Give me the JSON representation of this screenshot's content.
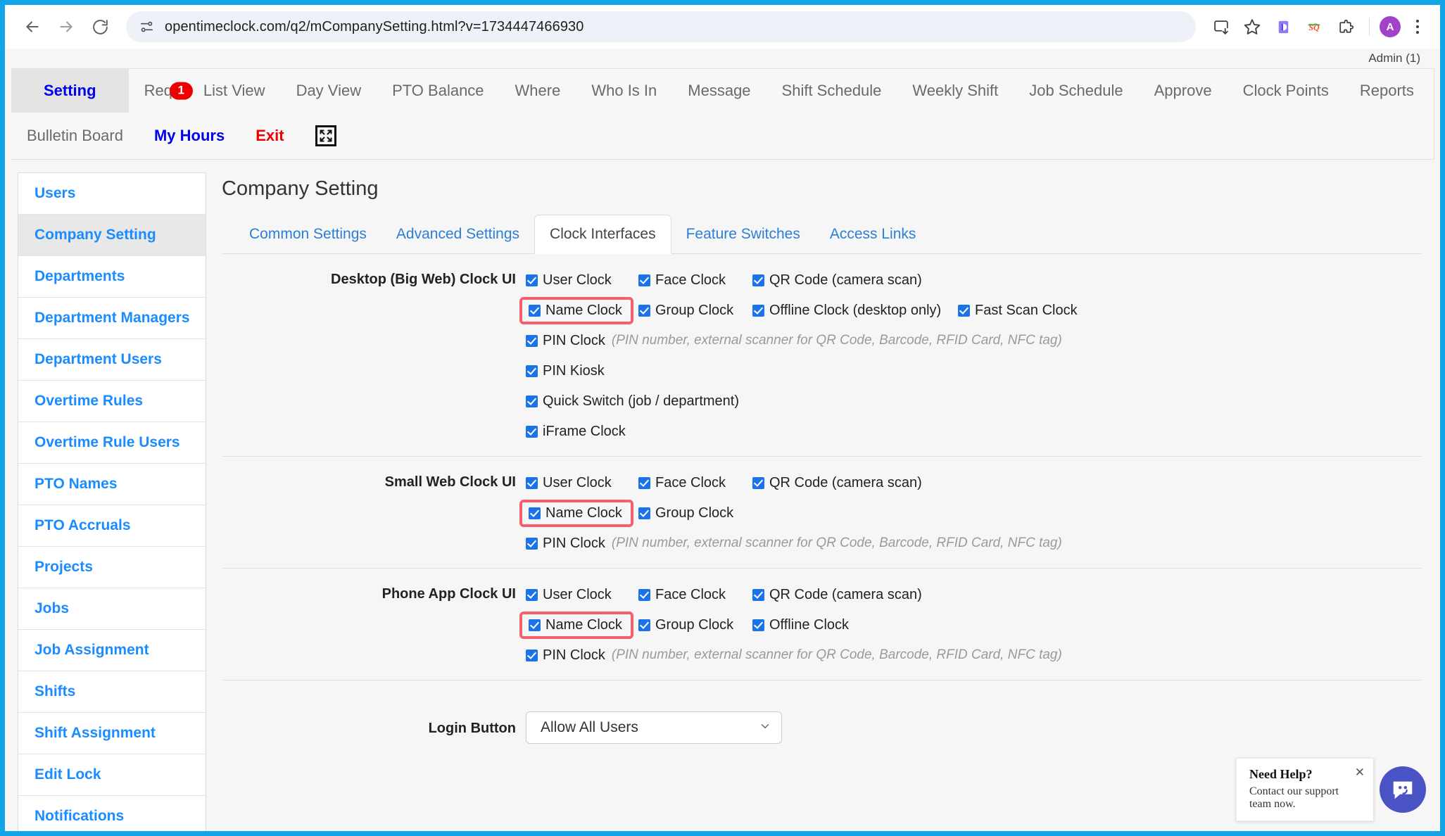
{
  "browser": {
    "url": "opentimeclock.com/q2/mCompanySetting.html?v=1734447466930",
    "back_icon": "back-arrow-icon",
    "forward_icon": "forward-arrow-icon",
    "reload_icon": "reload-icon",
    "site_info_icon": "site-settings-icon",
    "install_icon": "install-app-icon",
    "bookmark_icon": "star-icon",
    "extensions": [
      "extension-d-icon",
      "extension-sq-icon",
      "extensions-puzzle-icon"
    ],
    "profile_initial": "A",
    "menu_icon": "kebab-menu-icon"
  },
  "app": {
    "admin_label": "Admin (1)",
    "nav_row1": [
      {
        "label": "Setting",
        "active": true
      },
      {
        "label": "Req",
        "badge": "1"
      },
      {
        "label": "List View"
      },
      {
        "label": "Day View"
      },
      {
        "label": "PTO Balance"
      },
      {
        "label": "Where"
      },
      {
        "label": "Who Is In"
      },
      {
        "label": "Message"
      },
      {
        "label": "Shift Schedule"
      },
      {
        "label": "Weekly Shift"
      },
      {
        "label": "Job Schedule"
      },
      {
        "label": "Approve"
      },
      {
        "label": "Clock Points"
      },
      {
        "label": "Reports"
      }
    ],
    "nav_row2": [
      {
        "label": "Bulletin Board",
        "style": "gray"
      },
      {
        "label": "My Hours",
        "style": "blue"
      },
      {
        "label": "Exit",
        "style": "red"
      }
    ],
    "fullscreen_icon": "fullscreen-expand-icon"
  },
  "sidebar": {
    "items": [
      {
        "label": "Users"
      },
      {
        "label": "Company Setting",
        "active": true
      },
      {
        "label": "Departments"
      },
      {
        "label": "Department Managers"
      },
      {
        "label": "Department Users"
      },
      {
        "label": "Overtime Rules"
      },
      {
        "label": "Overtime Rule Users"
      },
      {
        "label": "PTO Names"
      },
      {
        "label": "PTO Accruals"
      },
      {
        "label": "Projects"
      },
      {
        "label": "Jobs"
      },
      {
        "label": "Job Assignment"
      },
      {
        "label": "Shifts"
      },
      {
        "label": "Shift Assignment"
      },
      {
        "label": "Edit Lock"
      },
      {
        "label": "Notifications"
      }
    ]
  },
  "main": {
    "title": "Company Setting",
    "subtabs": [
      {
        "label": "Common Settings",
        "active": false
      },
      {
        "label": "Advanced Settings",
        "active": false
      },
      {
        "label": "Clock Interfaces",
        "active": true
      },
      {
        "label": "Feature Switches",
        "active": false
      },
      {
        "label": "Access Links",
        "active": false
      }
    ],
    "pin_hint": "(PIN number, external scanner for QR Code, Barcode, RFID Card, NFC tag)",
    "sections": {
      "desktop": {
        "label": "Desktop (Big Web) Clock UI",
        "user_clock": "User Clock",
        "face_clock": "Face Clock",
        "qr_code": "QR Code (camera scan)",
        "name_clock": "Name Clock",
        "group_clock": "Group Clock",
        "offline_clock": "Offline Clock (desktop only)",
        "fast_scan_clock": "Fast Scan Clock",
        "pin_clock": "PIN Clock",
        "pin_kiosk": "PIN Kiosk",
        "quick_switch": "Quick Switch (job / department)",
        "iframe_clock": "iFrame Clock"
      },
      "small_web": {
        "label": "Small Web Clock UI",
        "user_clock": "User Clock",
        "face_clock": "Face Clock",
        "qr_code": "QR Code (camera scan)",
        "name_clock": "Name Clock",
        "group_clock": "Group Clock",
        "pin_clock": "PIN Clock"
      },
      "phone_app": {
        "label": "Phone App Clock UI",
        "user_clock": "User Clock",
        "face_clock": "Face Clock",
        "qr_code": "QR Code (camera scan)",
        "name_clock": "Name Clock",
        "group_clock": "Group Clock",
        "offline_clock": "Offline Clock",
        "pin_clock": "PIN Clock"
      }
    },
    "login_button": {
      "label": "Login Button",
      "value": "Allow All Users"
    }
  },
  "chat": {
    "title": "Need Help?",
    "subtitle": "Contact our support team now.",
    "close_icon": "close-icon",
    "fab_icon": "chat-bubble-icon"
  },
  "colors": {
    "accent_blue": "#1a8cff",
    "checkbox_blue": "#1a73e8",
    "highlight_red": "#f4616d",
    "badge_red": "#ee0000",
    "window_border": "#12a5e8",
    "chat_purple": "#4a53c4"
  }
}
